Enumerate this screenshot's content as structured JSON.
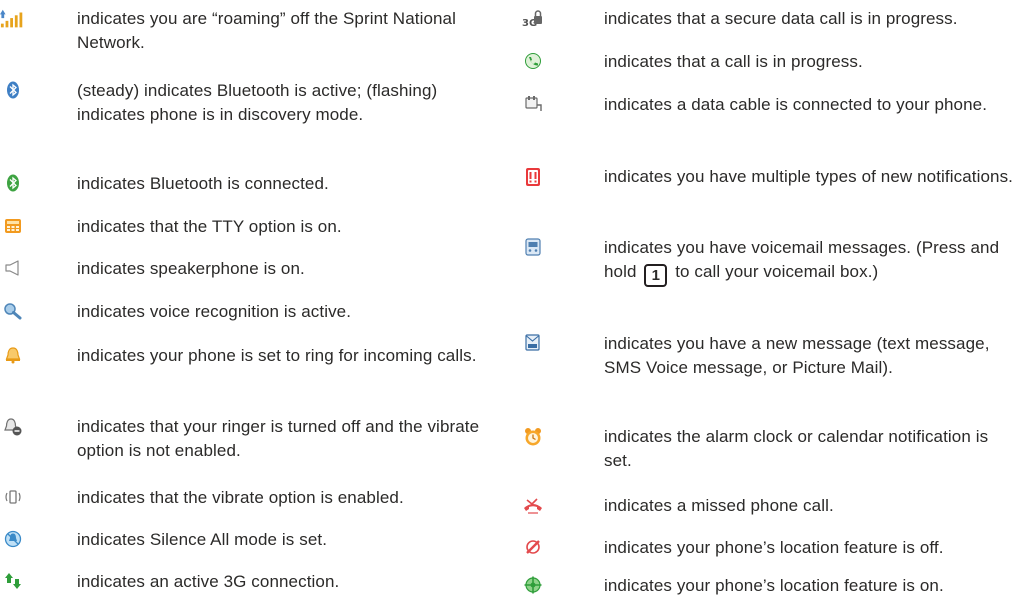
{
  "left_items": [
    {
      "icon": "roaming-signal-icon",
      "text": "indicates you are “roaming” off the Sprint National Network."
    },
    {
      "icon": "bluetooth-active-icon",
      "text": "(steady) indicates Bluetooth is active; (flashing) indicates phone is in discovery mode."
    },
    {
      "icon": "bluetooth-connected-icon",
      "text": "indicates Bluetooth is connected."
    },
    {
      "icon": "tty-icon",
      "text": "indicates that the TTY option is on."
    },
    {
      "icon": "speakerphone-icon",
      "text": "indicates speakerphone is on."
    },
    {
      "icon": "voice-recognition-icon",
      "text": "indicates voice recognition is active."
    },
    {
      "icon": "ringer-bell-icon",
      "text": "indicates your phone is set to ring for incoming calls."
    },
    {
      "icon": "ringer-off-icon",
      "text": "indicates that your ringer is turned off and the vibrate option is not enabled."
    },
    {
      "icon": "vibrate-icon",
      "text": "indicates that the vibrate option is enabled."
    },
    {
      "icon": "silence-all-icon",
      "text": "indicates Silence All mode is set."
    },
    {
      "icon": "3g-connection-icon",
      "text": "indicates an active 3G connection."
    }
  ],
  "right_items": [
    {
      "icon": "secure-data-call-icon",
      "text": "indicates that a secure data call is in progress."
    },
    {
      "icon": "call-in-progress-icon",
      "text": "indicates that a call is in progress."
    },
    {
      "icon": "data-cable-icon",
      "text": "indicates a data cable is connected to your phone."
    },
    {
      "icon": "multiple-notifications-icon",
      "text": "indicates you have multiple types of new notifications."
    },
    {
      "icon": "voicemail-icon",
      "text_before": "indicates you have voicemail messages. (Press and hold",
      "key": "1",
      "text_after": "to call your voicemail box.)"
    },
    {
      "icon": "new-message-icon",
      "text": "indicates you have a new message (text message, SMS Voice message, or Picture Mail)."
    },
    {
      "icon": "alarm-clock-icon",
      "text": "indicates the alarm clock or calendar notification is set."
    },
    {
      "icon": "missed-call-icon",
      "text": "indicates a missed phone call."
    },
    {
      "icon": "location-off-icon",
      "text": "indicates your phone’s location feature is off."
    },
    {
      "icon": "location-on-icon",
      "text": "indicates your phone’s location feature is on."
    }
  ]
}
